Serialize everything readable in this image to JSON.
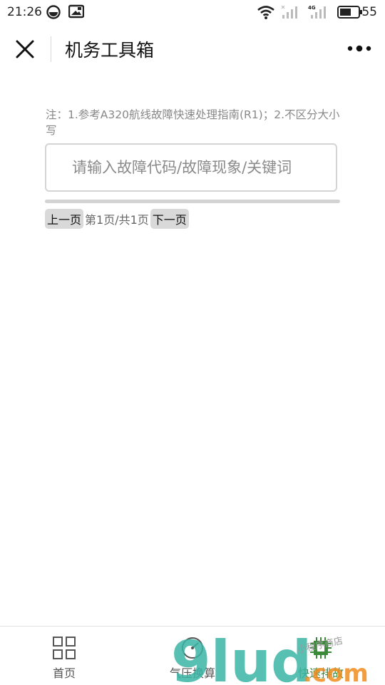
{
  "status_bar": {
    "time": "21:26",
    "battery": "55",
    "icons": [
      "signal-icon",
      "camera-icon",
      "wifi-icon",
      "cell-signal-icon",
      "4g-signal-icon",
      "battery-icon"
    ]
  },
  "nav": {
    "title": "机务工具箱",
    "close_icon": "close-icon",
    "more_icon": "more-icon"
  },
  "content": {
    "note": "注：1.参考A320航线故障快速处理指南(R1)；2.不区分大小写",
    "search": {
      "placeholder": "请输入故障代码/故障现象/关键词",
      "value": ""
    },
    "pager": {
      "prev_label": "上一页",
      "info": "第1页/共1页",
      "next_label": "下一页"
    }
  },
  "tabbar": {
    "tabs": [
      {
        "label": "首页",
        "icon": "grid-icon"
      },
      {
        "label": "气压换算",
        "icon": "gauge-icon"
      },
      {
        "label": "快速排故",
        "icon": "chip-icon"
      }
    ]
  },
  "watermark": {
    "brand": "9lud.com",
    "tag": "小程序商店"
  },
  "colors": {
    "watermark_teal": "#3ab5a5",
    "watermark_orange": "#f08c1e",
    "active_green": "#3a8a3a"
  }
}
